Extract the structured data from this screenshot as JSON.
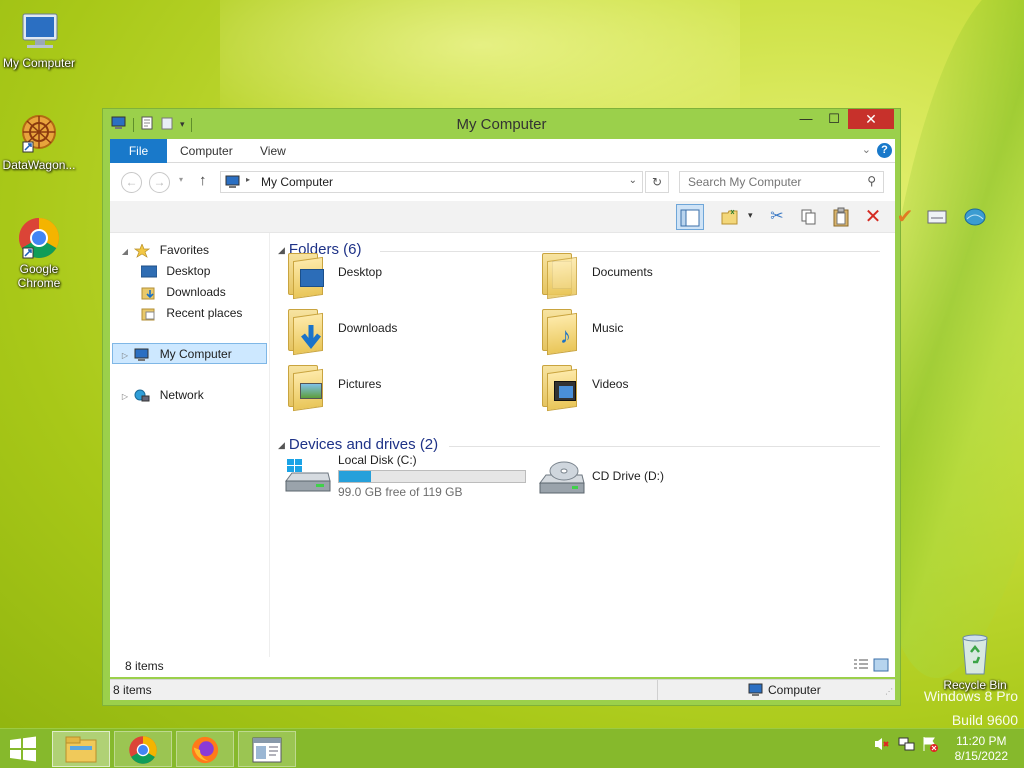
{
  "desktop": {
    "icons": [
      {
        "label": "My Computer",
        "icon": "computer-icon"
      },
      {
        "label": "DataWagon...",
        "icon": "datawagon-icon"
      },
      {
        "label": "Google Chrome",
        "icon": "chrome-icon"
      },
      {
        "label": "Recycle Bin",
        "icon": "recycle-bin-icon"
      }
    ],
    "watermark": {
      "line1": "Windows 8 Pro",
      "line2": "Build 9600"
    }
  },
  "window": {
    "title": "My Computer",
    "controls": {
      "minimize": "—",
      "maximize": "☐",
      "close": "✕"
    },
    "ribbon_tabs": [
      "File",
      "Computer",
      "View"
    ],
    "address": {
      "path": "My Computer"
    },
    "search": {
      "placeholder": "Search My Computer"
    },
    "nav": {
      "favorites": "Favorites",
      "favorites_items": [
        "Desktop",
        "Downloads",
        "Recent places"
      ],
      "my_computer": "My Computer",
      "network": "Network"
    },
    "folders_header": "Folders (6)",
    "folders": [
      {
        "name": "Desktop",
        "icon": "desktop-folder-icon"
      },
      {
        "name": "Documents",
        "icon": "documents-folder-icon"
      },
      {
        "name": "Downloads",
        "icon": "downloads-folder-icon"
      },
      {
        "name": "Music",
        "icon": "music-folder-icon"
      },
      {
        "name": "Pictures",
        "icon": "pictures-folder-icon"
      },
      {
        "name": "Videos",
        "icon": "videos-folder-icon"
      }
    ],
    "devices_header": "Devices and drives (2)",
    "drives": [
      {
        "name": "Local Disk (C:)",
        "free": "99.0 GB free of 119 GB",
        "used_fraction": 0.17
      },
      {
        "name": "CD Drive (D:)"
      }
    ],
    "inner_status": "8 items",
    "status": {
      "count": "8 items",
      "location": "Computer"
    }
  },
  "taskbar": {
    "clock_time": "11:20 PM",
    "clock_date": "8/15/2022"
  },
  "colors": {
    "accent": "#1979ca",
    "desktop": "#a8c818",
    "close": "#c7312b",
    "selection": "#cde8ff"
  }
}
